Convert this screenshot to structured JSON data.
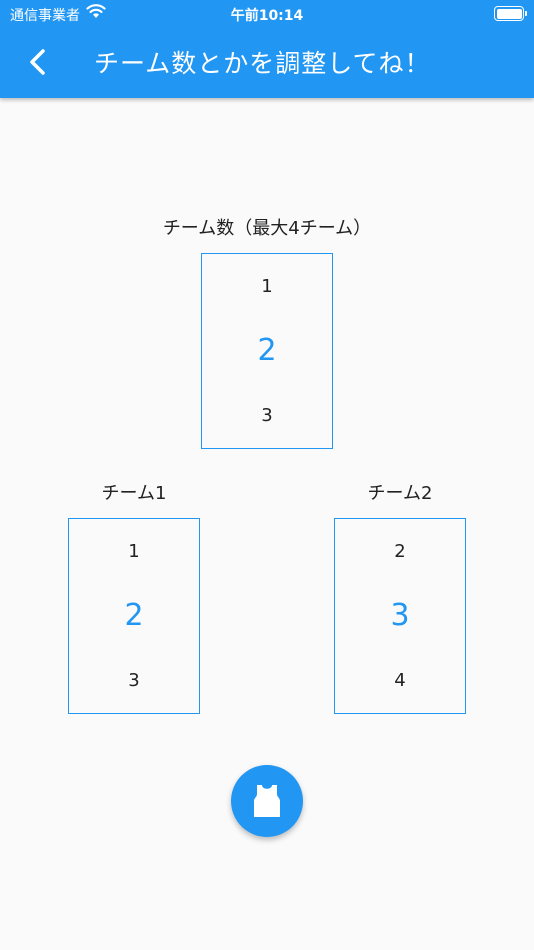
{
  "status_bar": {
    "carrier": "通信事業者",
    "time": "午前10:14"
  },
  "app_bar": {
    "title": "チーム数とかを調整してね！"
  },
  "team_count": {
    "label": "チーム数（最大4チーム）",
    "options": [
      "1",
      "2",
      "3"
    ],
    "selected": "2"
  },
  "team1": {
    "label": "チーム1",
    "options": [
      "1",
      "2",
      "3"
    ],
    "selected": "2"
  },
  "team2": {
    "label": "チーム2",
    "options": [
      "2",
      "3",
      "4"
    ],
    "selected": "3"
  },
  "colors": {
    "primary": "#2196f3",
    "background": "#fafafa"
  },
  "icons": {
    "back": "chevron-left-icon",
    "fab": "jersey-icon"
  }
}
